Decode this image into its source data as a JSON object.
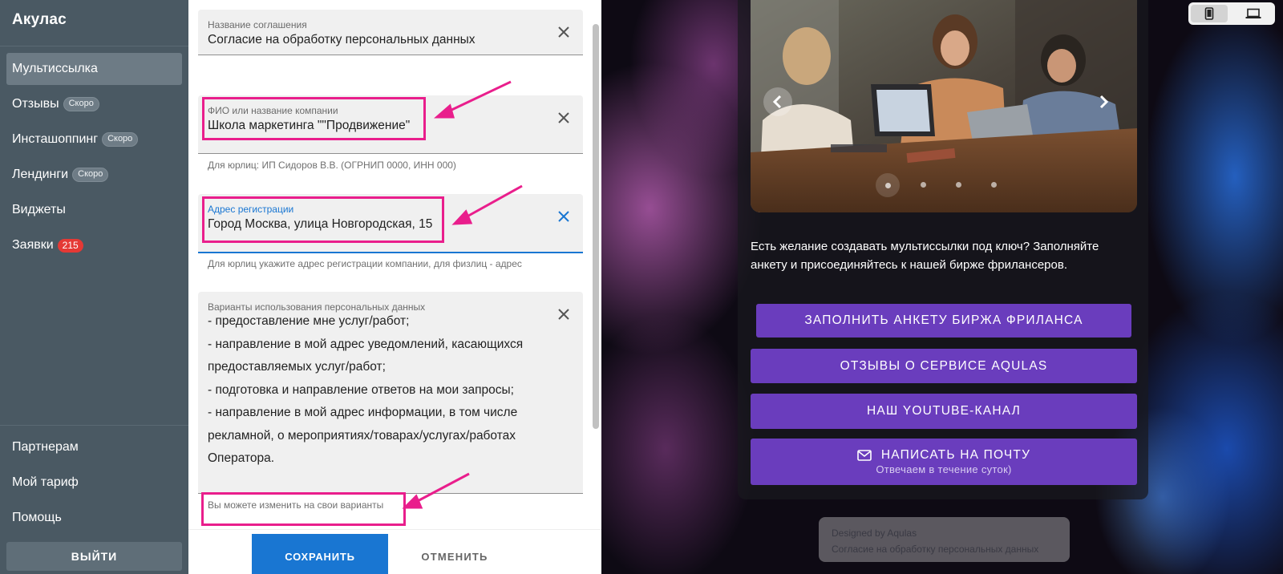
{
  "sidebar": {
    "brand": "Акулас",
    "items": [
      {
        "label": "Мультиссылка",
        "badge": ""
      },
      {
        "label": "Отзывы",
        "badge": "Скоро"
      },
      {
        "label": "Инсташоппинг",
        "badge": "Скоро"
      },
      {
        "label": "Лендинги",
        "badge": "Скоро"
      },
      {
        "label": "Виджеты",
        "badge": ""
      },
      {
        "label": "Заявки",
        "badge": "215"
      }
    ],
    "bottom_items": [
      {
        "label": "Партнерам"
      },
      {
        "label": "Мой тариф"
      },
      {
        "label": "Помощь"
      }
    ],
    "logout_label": "ВЫЙТИ"
  },
  "form": {
    "agreement_name": {
      "label": "Название соглашения",
      "value": "Согласие на обработку персональных данных"
    },
    "company": {
      "label": "ФИО или название компании",
      "value": "Школа маркетинга \"\"Продвижение\"",
      "helper": "Для юрлиц: ИП Сидоров В.В. (ОГРНИП 0000, ИНН 000)"
    },
    "address": {
      "label": "Адрес регистрации",
      "value": "Город Москва, улица Новгородская, 15",
      "helper": "Для юрлиц укажите адрес регистрации компании, для физлиц - адрес"
    },
    "usage": {
      "label": "Варианты использования персональных данных",
      "lines": [
        "- предоставление мне услуг/работ;",
        "- направление в мой адрес уведомлений, касающихся",
        "предоставляемых услуг/работ;",
        "- подготовка и направление ответов на мои запросы;",
        "- направление в мой адрес информации, в том числе",
        "рекламной, о мероприятиях/товарах/услугах/работах",
        "Оператора."
      ],
      "helper": "Вы можете изменить на свои варианты"
    },
    "save_label": "СОХРАНИТЬ",
    "cancel_label": "ОТМЕНИТЬ"
  },
  "preview": {
    "promo_text": "Есть желание создавать мультиссылки под ключ? Заполняйте анкету и присоединяйтесь к нашей бирже фрилансеров.",
    "buttons": [
      {
        "label": "ЗАПОЛНИТЬ АНКЕТУ БИРЖА ФРИЛАНСА"
      },
      {
        "label": "ОТЗЫВЫ О СЕРВИСЕ AQULAS"
      },
      {
        "label": "НАШ YOUTUBE-КАНАЛ"
      },
      {
        "label": "НАПИСАТЬ НА ПОЧТУ",
        "sublabel": "Отвечаем в течение суток)"
      }
    ],
    "footer": {
      "line1": "Designed by Aqulas",
      "line2": "Согласие на обработку персональных данных"
    }
  },
  "colors": {
    "sidebar_bg": "#4a5963",
    "accent_blue": "#1976d2",
    "highlight_pink": "#e91e8c",
    "button_purple": "#6a3dbd",
    "badge_red": "#e53935"
  },
  "icons": [
    "close-icon",
    "mail-icon",
    "chevron-left-icon",
    "chevron-right-icon",
    "phone-icon",
    "laptop-icon"
  ]
}
